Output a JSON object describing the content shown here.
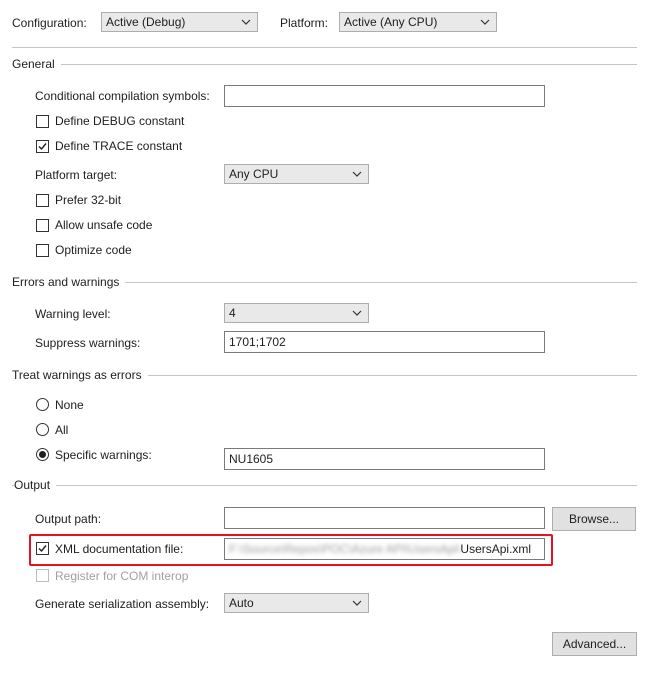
{
  "header": {
    "configuration_label": "Configuration:",
    "configuration_value": "Active (Debug)",
    "platform_label": "Platform:",
    "platform_value": "Active (Any CPU)"
  },
  "general": {
    "title": "General",
    "conditional_symbols_label": "Conditional compilation symbols:",
    "conditional_symbols_value": "",
    "define_debug_label": "Define DEBUG constant",
    "define_debug_checked": false,
    "define_trace_label": "Define TRACE constant",
    "define_trace_checked": true,
    "platform_target_label": "Platform target:",
    "platform_target_value": "Any CPU",
    "prefer32_label": "Prefer 32-bit",
    "prefer32_checked": false,
    "unsafe_label": "Allow unsafe code",
    "unsafe_checked": false,
    "optimize_label": "Optimize code",
    "optimize_checked": false
  },
  "errors": {
    "title": "Errors and warnings",
    "warning_level_label": "Warning level:",
    "warning_level_value": "4",
    "suppress_label": "Suppress warnings:",
    "suppress_value": "1701;1702"
  },
  "treat": {
    "title": "Treat warnings as errors",
    "none_label": "None",
    "all_label": "All",
    "specific_label": "Specific warnings:",
    "selected": "specific",
    "specific_value": "NU1605"
  },
  "output": {
    "title": "Output",
    "output_path_label": "Output path:",
    "output_path_value": "",
    "browse_label": "Browse...",
    "xml_doc_label": "XML documentation file:",
    "xml_doc_checked": true,
    "xml_doc_path_obscured": "F:\\Source\\Repos\\POC\\Azure API\\UsersApi\\",
    "xml_doc_filename": "UsersApi.xml",
    "com_interop_label": "Register for COM interop",
    "serialization_label": "Generate serialization assembly:",
    "serialization_value": "Auto",
    "advanced_label": "Advanced..."
  },
  "colors": {
    "highlight": "#e81123",
    "check": "#1e1e1e"
  }
}
